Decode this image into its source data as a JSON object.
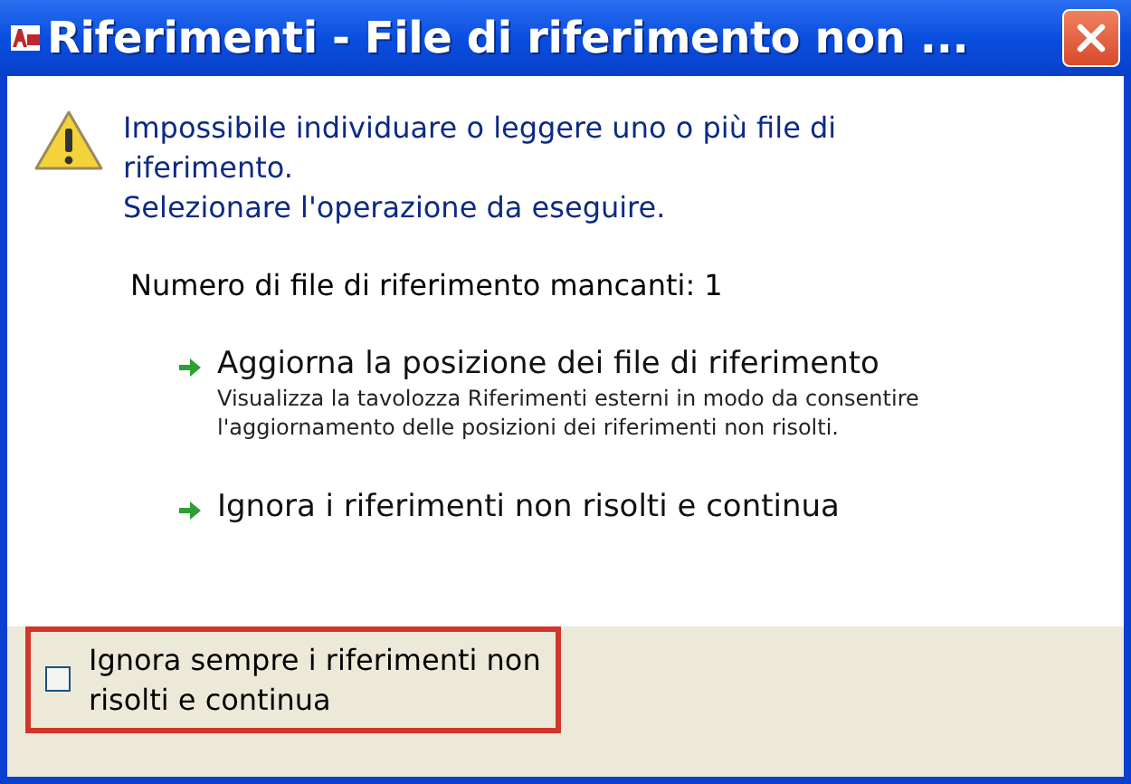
{
  "window": {
    "title": "Riferimenti - File di riferimento non ..."
  },
  "message": {
    "lines": [
      "Impossibile individuare o leggere uno o più file di riferimento.",
      "Selezionare l'operazione da eseguire."
    ]
  },
  "missing_count": "Numero di file di riferimento mancanti: 1",
  "options": [
    {
      "label": "Aggiorna la posizione dei file di riferimento",
      "description": "Visualizza la tavolozza Riferimenti esterni in modo da consentire l'aggiornamento delle posizioni dei riferimenti non risolti."
    },
    {
      "label": "Ignora i riferimenti non risolti e continua"
    }
  ],
  "footer": {
    "checkbox": {
      "label": "Ignora sempre i riferimenti non risolti e continua",
      "checked": false,
      "highlighted": true
    }
  }
}
